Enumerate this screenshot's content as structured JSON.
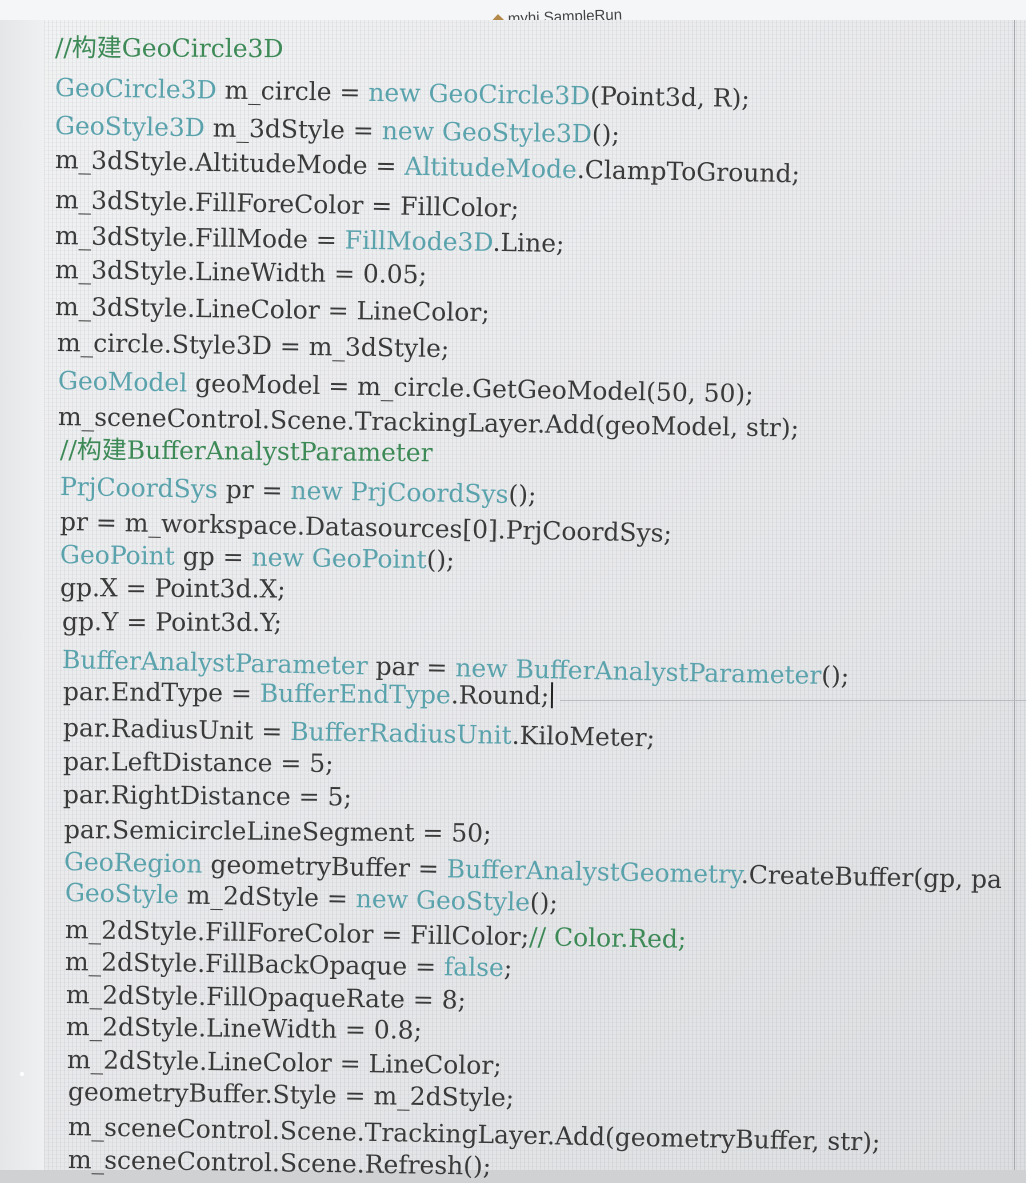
{
  "editor": {
    "tab_title": "myhj.SampleRun",
    "tab_icon": "method-icon",
    "lines": [
      {
        "segments": [
          {
            "text": "//构建GeoCircle3D",
            "kind": "comment"
          }
        ]
      },
      {
        "segments": [
          {
            "text": "GeoCircle3D",
            "kind": "type"
          },
          {
            "text": " m_circle = ",
            "kind": "plain"
          },
          {
            "text": "new",
            "kind": "keyword"
          },
          {
            "text": " ",
            "kind": "plain"
          },
          {
            "text": "GeoCircle3D",
            "kind": "type"
          },
          {
            "text": "(Point3d, R);",
            "kind": "plain"
          }
        ]
      },
      {
        "segments": [
          {
            "text": "GeoStyle3D",
            "kind": "type"
          },
          {
            "text": " m_3dStyle = ",
            "kind": "plain"
          },
          {
            "text": "new",
            "kind": "keyword"
          },
          {
            "text": " ",
            "kind": "plain"
          },
          {
            "text": "GeoStyle3D",
            "kind": "type"
          },
          {
            "text": "();",
            "kind": "plain"
          }
        ]
      },
      {
        "segments": [
          {
            "text": "m_3dStyle.AltitudeMode = ",
            "kind": "plain"
          },
          {
            "text": "AltitudeMode",
            "kind": "type"
          },
          {
            "text": ".ClampToGround;",
            "kind": "plain"
          }
        ]
      },
      {
        "segments": [
          {
            "text": "m_3dStyle.FillForeColor = FillColor;",
            "kind": "plain"
          }
        ]
      },
      {
        "segments": [
          {
            "text": "m_3dStyle.FillMode = ",
            "kind": "plain"
          },
          {
            "text": "FillMode3D",
            "kind": "type"
          },
          {
            "text": ".Line;",
            "kind": "plain"
          }
        ]
      },
      {
        "segments": [
          {
            "text": "m_3dStyle.LineWidth = 0.05;",
            "kind": "plain"
          }
        ]
      },
      {
        "segments": [
          {
            "text": "m_3dStyle.LineColor = LineColor;",
            "kind": "plain"
          }
        ]
      },
      {
        "segments": [
          {
            "text": "m_circle.Style3D = m_3dStyle;",
            "kind": "plain"
          }
        ]
      },
      {
        "segments": [
          {
            "text": "GeoModel",
            "kind": "type"
          },
          {
            "text": " geoModel = m_circle.GetGeoModel(50, 50);",
            "kind": "plain"
          }
        ]
      },
      {
        "segments": [
          {
            "text": "m_sceneControl.Scene.TrackingLayer.Add(geoModel, str);",
            "kind": "plain"
          }
        ]
      },
      {
        "segments": [
          {
            "text": "//构建BufferAnalystParameter",
            "kind": "comment"
          }
        ]
      },
      {
        "segments": [
          {
            "text": "PrjCoordSys",
            "kind": "type"
          },
          {
            "text": " pr = ",
            "kind": "plain"
          },
          {
            "text": "new",
            "kind": "keyword"
          },
          {
            "text": " ",
            "kind": "plain"
          },
          {
            "text": "PrjCoordSys",
            "kind": "type"
          },
          {
            "text": "();",
            "kind": "plain"
          }
        ]
      },
      {
        "segments": [
          {
            "text": "pr = m_workspace.Datasources[0].PrjCoordSys;",
            "kind": "plain"
          }
        ]
      },
      {
        "segments": [
          {
            "text": "GeoPoint",
            "kind": "type"
          },
          {
            "text": " gp = ",
            "kind": "plain"
          },
          {
            "text": "new",
            "kind": "keyword"
          },
          {
            "text": " ",
            "kind": "plain"
          },
          {
            "text": "GeoPoint",
            "kind": "type"
          },
          {
            "text": "();",
            "kind": "plain"
          }
        ]
      },
      {
        "segments": [
          {
            "text": "gp.X = Point3d.X;",
            "kind": "plain"
          }
        ]
      },
      {
        "segments": [
          {
            "text": "gp.Y = Point3d.Y;",
            "kind": "plain"
          }
        ]
      },
      {
        "segments": [
          {
            "text": "BufferAnalystParameter",
            "kind": "type"
          },
          {
            "text": " par = ",
            "kind": "plain"
          },
          {
            "text": "new",
            "kind": "keyword"
          },
          {
            "text": " ",
            "kind": "plain"
          },
          {
            "text": "BufferAnalystParameter",
            "kind": "type"
          },
          {
            "text": "();",
            "kind": "plain"
          }
        ]
      },
      {
        "segments": [
          {
            "text": "par.EndType = ",
            "kind": "plain"
          },
          {
            "text": "BufferEndType",
            "kind": "type"
          },
          {
            "text": ".Round;",
            "kind": "plain"
          }
        ],
        "caret": true
      },
      {
        "segments": [
          {
            "text": "par.RadiusUnit = ",
            "kind": "plain"
          },
          {
            "text": "BufferRadiusUnit",
            "kind": "type"
          },
          {
            "text": ".KiloMeter;",
            "kind": "plain"
          }
        ]
      },
      {
        "segments": [
          {
            "text": "par.LeftDistance = 5;",
            "kind": "plain"
          }
        ]
      },
      {
        "segments": [
          {
            "text": "par.RightDistance = 5;",
            "kind": "plain"
          }
        ]
      },
      {
        "segments": [
          {
            "text": "par.SemicircleLineSegment = 50;",
            "kind": "plain"
          }
        ]
      },
      {
        "segments": [
          {
            "text": "GeoRegion",
            "kind": "type"
          },
          {
            "text": " geometryBuffer = ",
            "kind": "plain"
          },
          {
            "text": "BufferAnalystGeometry",
            "kind": "type"
          },
          {
            "text": ".CreateBuffer(gp, pa",
            "kind": "plain"
          }
        ]
      },
      {
        "segments": [
          {
            "text": "GeoStyle",
            "kind": "type"
          },
          {
            "text": " m_2dStyle = ",
            "kind": "plain"
          },
          {
            "text": "new",
            "kind": "keyword"
          },
          {
            "text": " ",
            "kind": "plain"
          },
          {
            "text": "GeoStyle",
            "kind": "type"
          },
          {
            "text": "();",
            "kind": "plain"
          }
        ]
      },
      {
        "segments": [
          {
            "text": "m_2dStyle.FillForeColor = FillColor;",
            "kind": "plain"
          },
          {
            "text": "// Color.Red;",
            "kind": "comment"
          }
        ]
      },
      {
        "segments": [
          {
            "text": "m_2dStyle.FillBackOpaque = ",
            "kind": "plain"
          },
          {
            "text": "false",
            "kind": "keyword"
          },
          {
            "text": ";",
            "kind": "plain"
          }
        ]
      },
      {
        "segments": [
          {
            "text": "m_2dStyle.FillOpaqueRate = 8;",
            "kind": "plain"
          }
        ]
      },
      {
        "segments": [
          {
            "text": "m_2dStyle.LineWidth = 0.8;",
            "kind": "plain"
          }
        ]
      },
      {
        "segments": [
          {
            "text": "m_2dStyle.LineColor = LineColor;",
            "kind": "plain"
          }
        ]
      },
      {
        "segments": [
          {
            "text": "geometryBuffer.Style = m_2dStyle;",
            "kind": "plain"
          }
        ]
      },
      {
        "segments": [
          {
            "text": "m_sceneControl.Scene.TrackingLayer.Add(geometryBuffer, str);",
            "kind": "plain"
          }
        ]
      },
      {
        "segments": [
          {
            "text": "m_sceneControl.Scene.Refresh();",
            "kind": "plain"
          }
        ]
      }
    ]
  },
  "colors": {
    "plain": "#3a3a3a",
    "type": "#5aa3ad",
    "keyword": "#5aa3ad",
    "comment": "#3d8a57",
    "background": "#ebeced"
  }
}
